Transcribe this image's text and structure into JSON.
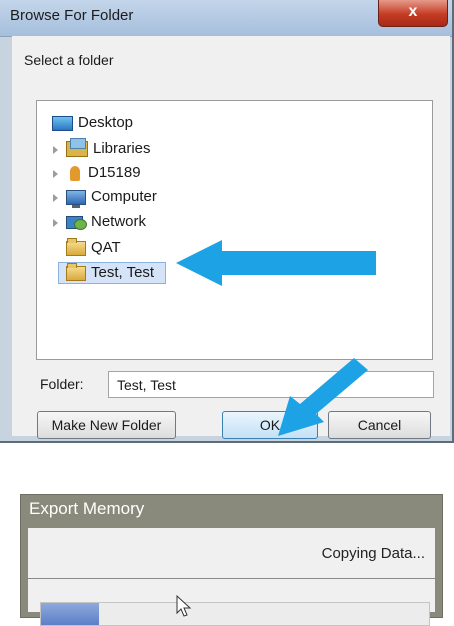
{
  "browse_dialog": {
    "title": "Browse For Folder",
    "close_glyph": "x",
    "prompt": "Select a folder",
    "tree": [
      {
        "label": "Desktop",
        "icon": "desktop-icon",
        "expandable": false
      },
      {
        "label": "Libraries",
        "icon": "libraries-icon",
        "expandable": true
      },
      {
        "label": "D15189",
        "icon": "user-folder-icon",
        "expandable": true
      },
      {
        "label": "Computer",
        "icon": "computer-icon",
        "expandable": true
      },
      {
        "label": "Network",
        "icon": "network-icon",
        "expandable": true
      },
      {
        "label": "QAT",
        "icon": "folder-icon",
        "expandable": false
      },
      {
        "label": "Test, Test",
        "icon": "folder-icon",
        "expandable": false,
        "selected": true
      }
    ],
    "folder_label": "Folder:",
    "folder_value": "Test, Test",
    "make_new_folder_label": "Make New Folder",
    "ok_label": "OK",
    "cancel_label": "Cancel",
    "annotation_arrow_color": "#1ea2e6"
  },
  "export_memory": {
    "title": "Export Memory",
    "status": "Copying Data...",
    "progress": 0.15
  }
}
